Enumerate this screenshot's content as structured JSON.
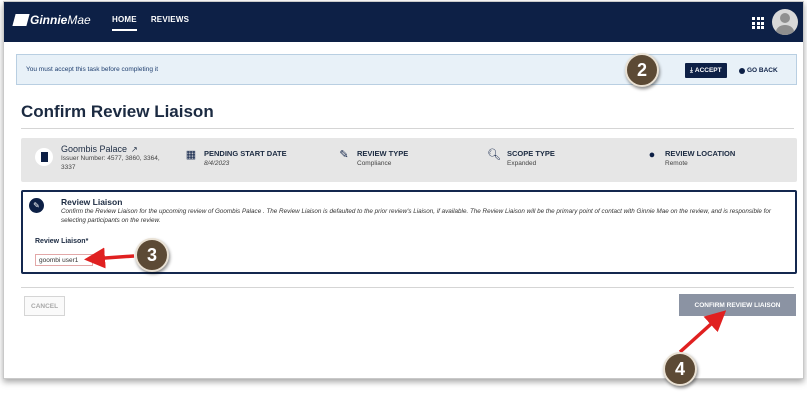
{
  "topbar": {
    "logo_ginnie": "Ginnie",
    "logo_mae": "Mae",
    "nav": [
      {
        "label": "HOME",
        "active": true
      },
      {
        "label": "REVIEWS",
        "active": false
      }
    ],
    "icons": [
      "apps-grid-icon",
      "user-avatar"
    ]
  },
  "alert": {
    "text": "You must accept this task before completing it",
    "accept_label": "ACCEPT",
    "goback_label": "GO BACK"
  },
  "page_title": "Confirm Review Liaison",
  "info": {
    "org_name": "Goombis Palace",
    "org_sub": "Issuer Number: 4577, 3860, 3364, 3337",
    "pending_label": "PENDING START DATE",
    "pending_value": "8/4/2023",
    "review_type_label": "REVIEW TYPE",
    "review_type_value": "Compliance",
    "scope_label": "SCOPE TYPE",
    "scope_value": "Expanded",
    "location_label": "REVIEW LOCATION",
    "location_value": "Remote"
  },
  "panel": {
    "title": "Review Liaison",
    "description": "Confirm the Review Liaison for the upcoming review of Goombis Palace . The Review Liaison is defaulted to the prior review's Liaison, if available. The Review Liaison will be the primary point of contact with Ginnie Mae on the review, and is responsible for selecting participants on the review.",
    "field_label": "Review Liaison",
    "field_required": "*",
    "field_value": "goombi user1"
  },
  "actions": {
    "cancel_label": "CANCEL",
    "confirm_label": "CONFIRM REVIEW LIAISON"
  },
  "callouts": [
    "2",
    "3",
    "4"
  ],
  "colors": {
    "navy": "#0d2046",
    "alert_bg": "#e8f1f8",
    "callout": "#5c4a35",
    "arrow": "#e02020",
    "confirm_disabled": "#8b93a3"
  }
}
